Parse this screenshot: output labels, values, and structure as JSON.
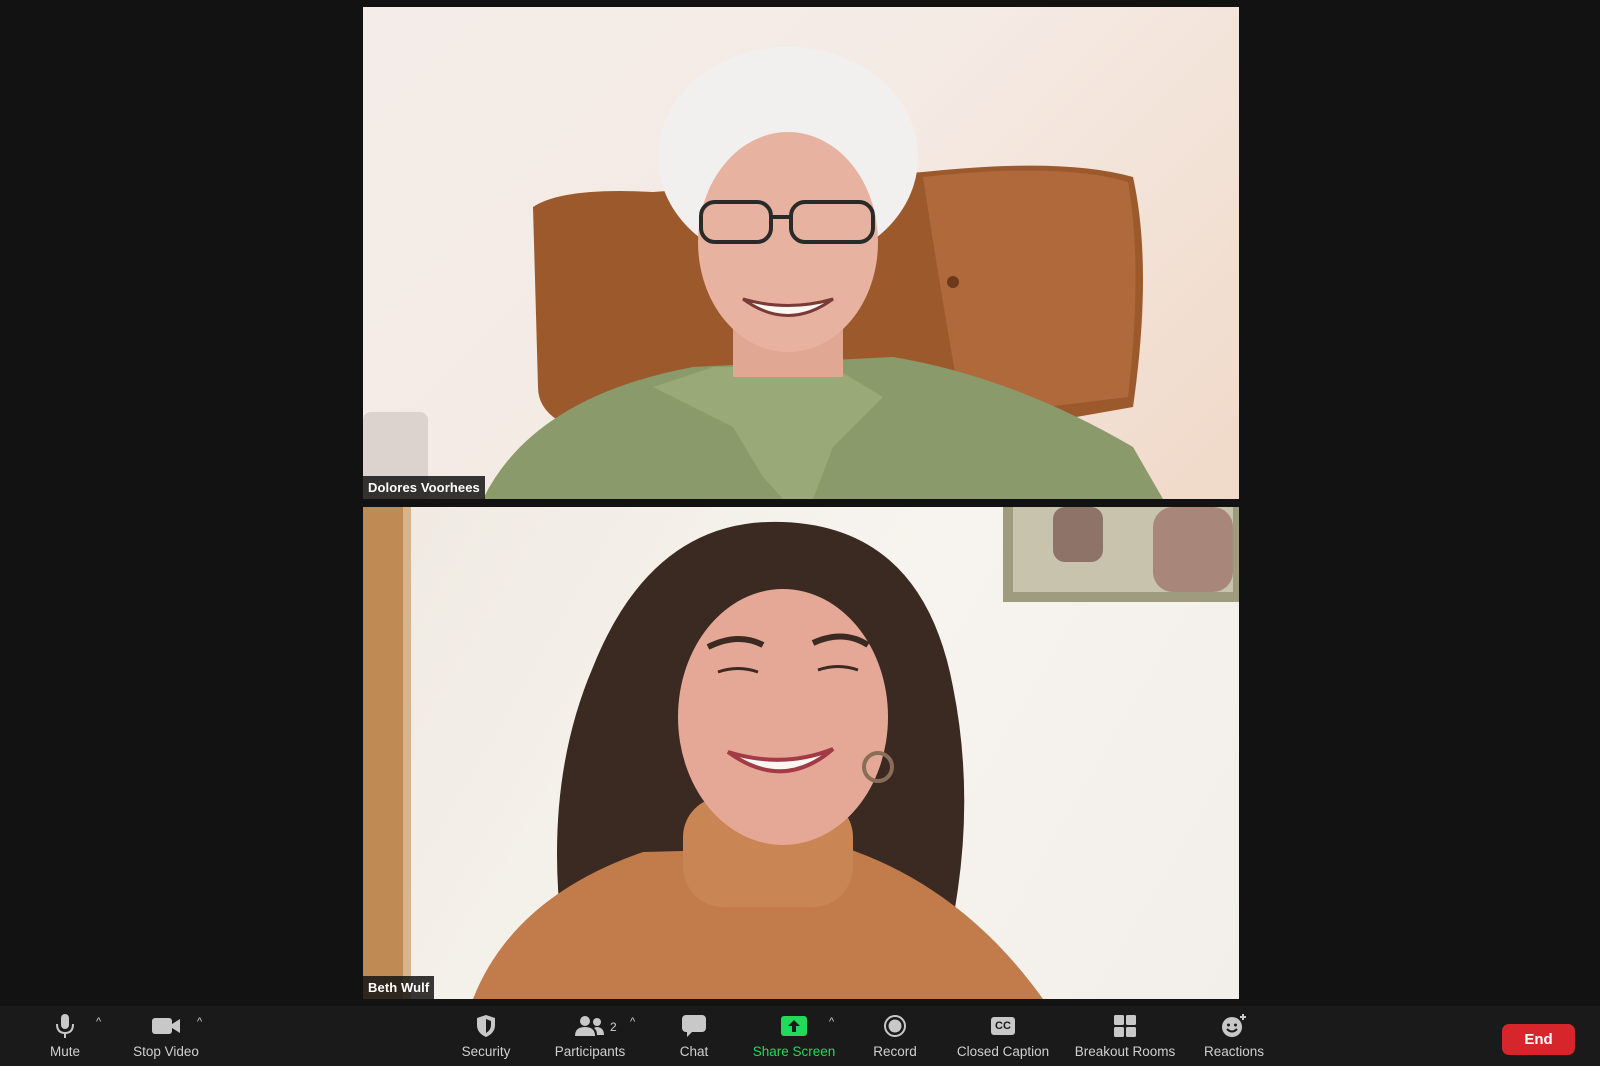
{
  "participants": [
    {
      "name": "Dolores Voorhees"
    },
    {
      "name": "Beth Wulf"
    }
  ],
  "toolbar": {
    "mute_label": "Mute",
    "stop_video_label": "Stop Video",
    "security_label": "Security",
    "participants_label": "Participants",
    "participants_count": "2",
    "chat_label": "Chat",
    "share_screen_label": "Share Screen",
    "record_label": "Record",
    "closed_caption_label": "Closed Caption",
    "closed_caption_glyph": "CC",
    "breakout_rooms_label": "Breakout Rooms",
    "reactions_label": "Reactions",
    "end_label": "End",
    "caret_glyph": "^"
  },
  "colors": {
    "toolbar_bg": "#1a1a1a",
    "share_screen_green": "#23d959",
    "end_red": "#d7262b"
  },
  "icons": [
    "microphone-icon",
    "video-camera-icon",
    "shield-icon",
    "participants-icon",
    "chat-bubble-icon",
    "share-screen-icon",
    "record-icon",
    "closed-caption-icon",
    "breakout-rooms-icon",
    "reactions-icon"
  ]
}
